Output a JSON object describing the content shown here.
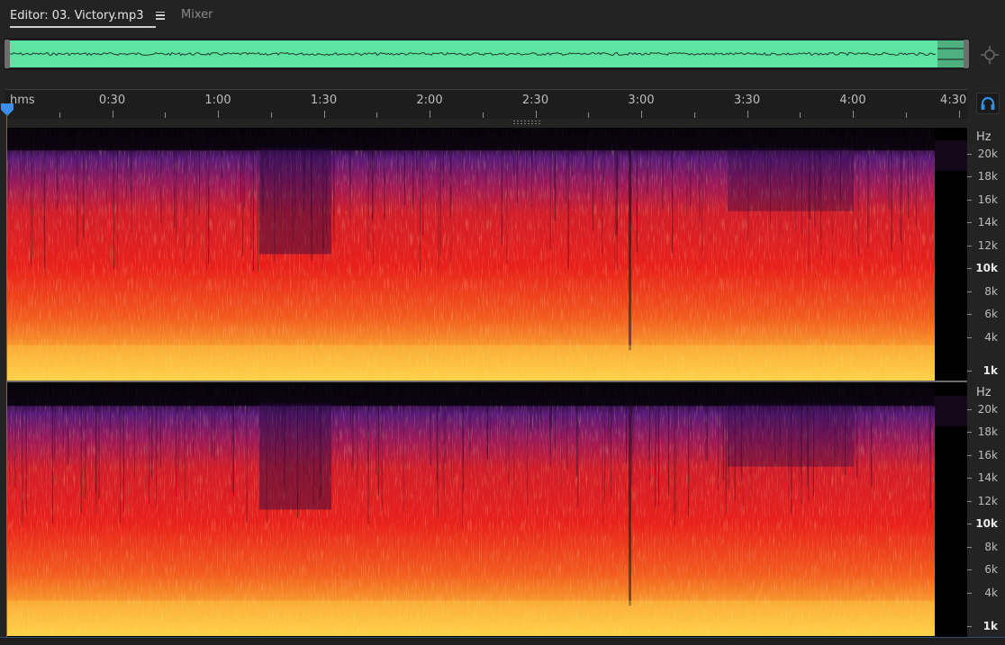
{
  "tabs": {
    "editor_label": "Editor: 03. Victory.mp3",
    "mixer_label": "Mixer"
  },
  "timeline": {
    "unit_label": "hms",
    "labels": [
      "0:30",
      "1:00",
      "1:30",
      "2:00",
      "2:30",
      "3:00",
      "3:30",
      "4:00",
      "4:30"
    ]
  },
  "playhead": {
    "time": "0:00"
  },
  "frequency_scale": {
    "unit_label": "Hz",
    "labels": [
      "20k",
      "18k",
      "16k",
      "14k",
      "12k",
      "10k",
      "8k",
      "6k",
      "4k",
      "1k"
    ],
    "bold_labels": [
      "10k",
      "1k"
    ]
  },
  "channels": [
    "top",
    "bottom"
  ],
  "colors": {
    "waveform": "#5ee4a2",
    "spectrogram_low": "#ffd24a",
    "spectrogram_mid": "#e8201c",
    "spectrogram_high": "#5a1a78",
    "playhead": "#3d8eea",
    "accent": "#2f8ee6"
  },
  "icons": {
    "menu": "hamburger-icon",
    "zoom": "zoom-to-fit-icon",
    "monitor": "headphones-icon",
    "playhead": "playhead-marker-icon"
  }
}
